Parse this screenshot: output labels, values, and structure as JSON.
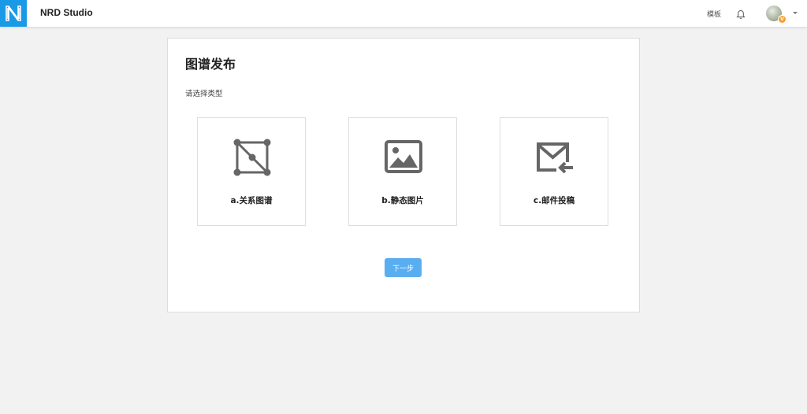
{
  "header": {
    "brand": "NRD Studio",
    "nav_template": "模板",
    "logo_icon": "nrd-logo-icon",
    "bell_icon": "bell-icon",
    "avatar_badge": "V"
  },
  "colors": {
    "accent": "#1a9ae6",
    "button": "#59aef0",
    "icon": "#666666",
    "badge": "#f5a030"
  },
  "main": {
    "title": "图谱发布",
    "subtitle": "请选择类型",
    "options": [
      {
        "label": "a.关系图谱",
        "icon": "graph-icon"
      },
      {
        "label": "b.静态图片",
        "icon": "image-icon"
      },
      {
        "label": "c.邮件投稿",
        "icon": "mail-icon"
      }
    ],
    "next_label": "下一步"
  }
}
